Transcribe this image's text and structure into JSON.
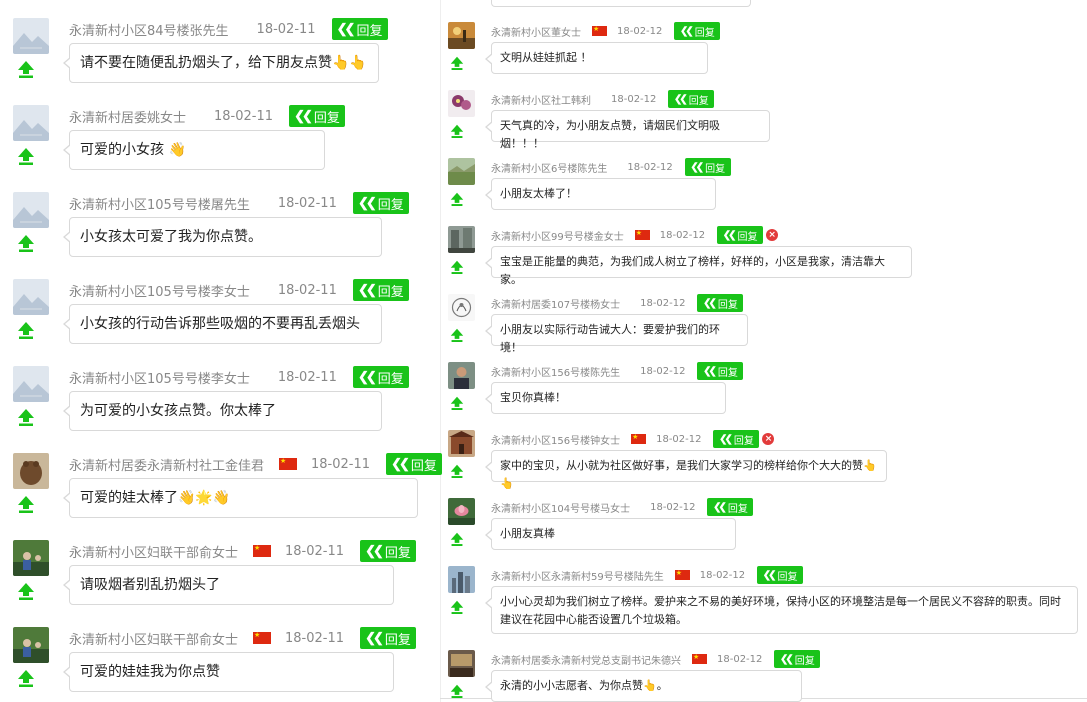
{
  "colors": {
    "reply_green": "#19c319",
    "name_gray": "#888888",
    "border": "#d9d9d9",
    "flag_red": "#de2910",
    "delete_red": "#e23b3b"
  },
  "icons": {
    "upvote": "up-arrow-icon",
    "reply": "reply-arrow-icon",
    "delete": "delete-x-icon",
    "flag": "flag-icon"
  },
  "left_comments": [
    {
      "name": "永清新村小区84号楼张先生",
      "date": "18-02-11",
      "reply_label": "回复",
      "text": "请不要在随便乱扔烟头了，给下朋友点赞👆👆",
      "avatar": "placeholder"
    },
    {
      "name": "永清新村居委姚女士",
      "date": "18-02-11",
      "reply_label": "回复",
      "text": "可爱的小女孩 👋",
      "avatar": "placeholder"
    },
    {
      "name": "永清新村小区105号号楼屠先生",
      "date": "18-02-11",
      "reply_label": "回复",
      "text": "小女孩太可爱了我为你点赞。",
      "avatar": "placeholder"
    },
    {
      "name": "永清新村小区105号号楼李女士",
      "date": "18-02-11",
      "reply_label": "回复",
      "text": "小女孩的行动告诉那些吸烟的不要再乱丢烟头",
      "avatar": "placeholder"
    },
    {
      "name": "永清新村小区105号号楼李女士",
      "date": "18-02-11",
      "reply_label": "回复",
      "text": "为可爱的小女孩点赞。你太棒了",
      "avatar": "placeholder"
    },
    {
      "name": "永清新村居委永清新村社工金佳君",
      "flag": true,
      "date": "18-02-11",
      "reply_label": "回复",
      "text": "可爱的娃太棒了👋🌟👋",
      "avatar": "animal"
    },
    {
      "name": "永清新村小区妇联干部俞女士",
      "flag": true,
      "date": "18-02-11",
      "reply_label": "回复",
      "text": "请吸烟者别乱扔烟头了",
      "avatar": "outdoor"
    },
    {
      "name": "永清新村小区妇联干部俞女士",
      "flag": true,
      "date": "18-02-11",
      "reply_label": "回复",
      "text": "可爱的娃娃我为你点赞",
      "avatar": "outdoor"
    }
  ],
  "right_comments": [
    {
      "name": "永清新村小区董女士",
      "flag": true,
      "date": "18-02-12",
      "reply_label": "回复",
      "text": "文明从娃娃抓起 ！",
      "avatar": "sunset"
    },
    {
      "name": "永清新村小区社工韩利",
      "date": "18-02-12",
      "reply_label": "回复",
      "text": "天气真的冷，为小朋友点赞，请烟民们文明吸烟！！！",
      "avatar": "flowers"
    },
    {
      "name": "永清新村小区6号楼陈先生",
      "date": "18-02-12",
      "reply_label": "回复",
      "text": "小朋友太棒了！",
      "avatar": "landscape"
    },
    {
      "name": "永清新村小区99号号楼金女士",
      "flag": true,
      "date": "18-02-12",
      "reply_label": "回复",
      "delete": true,
      "text": "宝宝是正能量的典范，为我们成人树立了榜样，好样的，小区是我家，清洁靠大家。",
      "avatar": "street"
    },
    {
      "name": "永清新村居委107号楼杨女士",
      "date": "18-02-12",
      "reply_label": "回复",
      "text": "小朋友以实际行动告诫大人：要爱护我们的环境！",
      "avatar": "drawing"
    },
    {
      "name": "永清新村小区156号楼陈先生",
      "date": "18-02-12",
      "reply_label": "回复",
      "text": "宝贝你真棒！",
      "avatar": "portrait"
    },
    {
      "name": "永清新村小区156号楼钟女士",
      "flag": true,
      "date": "18-02-12",
      "reply_label": "回复",
      "delete": true,
      "text": "家中的宝贝，从小就为社区做好事，是我们大家学习的榜样给你个大大的赞👆👆",
      "avatar": "building"
    },
    {
      "name": "永清新村小区104号号楼马女士",
      "date": "18-02-12",
      "reply_label": "回复",
      "text": "小朋友真棒",
      "avatar": "lotus"
    },
    {
      "name": "永清新村小区永清新村59号号楼陆先生",
      "flag": true,
      "date": "18-02-12",
      "reply_label": "回复",
      "text": "小小心灵却为我们树立了榜样。爱护来之不易的美好环境，保持小区的环境整洁是每一个居民义不容辞的职责。同时建议在花园中心能否设置几个垃圾箱。",
      "avatar": "city"
    },
    {
      "name": "永清新村居委永清新村党总支副书记朱德兴",
      "flag": true,
      "date": "18-02-12",
      "reply_label": "回复",
      "text": "永清的小小志愿者、为你点赞👆。",
      "avatar": "room"
    }
  ]
}
